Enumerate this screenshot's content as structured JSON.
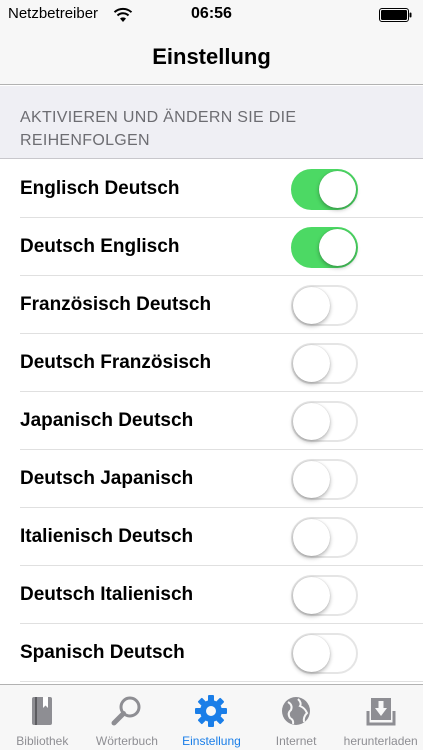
{
  "status_bar": {
    "carrier": "Netzbetreiber",
    "time": "06:56"
  },
  "nav": {
    "title": "Einstellung"
  },
  "section_header": "AKTIVIEREN UND ÄNDERN SIE DIE REIHENFOLGEN",
  "rows": [
    {
      "label": "Englisch Deutsch",
      "on": true
    },
    {
      "label": "Deutsch Englisch",
      "on": true
    },
    {
      "label": "Französisch Deutsch",
      "on": false
    },
    {
      "label": "Deutsch Französisch",
      "on": false
    },
    {
      "label": "Japanisch Deutsch",
      "on": false
    },
    {
      "label": "Deutsch Japanisch",
      "on": false
    },
    {
      "label": "Italienisch Deutsch",
      "on": false
    },
    {
      "label": "Deutsch Italienisch",
      "on": false
    },
    {
      "label": "Spanisch Deutsch",
      "on": false
    }
  ],
  "tabs": [
    {
      "label": "Bibliothek",
      "icon": "book-icon",
      "active": false
    },
    {
      "label": "Wörterbuch",
      "icon": "magnifier-icon",
      "active": false
    },
    {
      "label": "Einstellung",
      "icon": "gear-icon",
      "active": true
    },
    {
      "label": "Internet",
      "icon": "globe-icon",
      "active": false
    },
    {
      "label": "herunterladen",
      "icon": "download-icon",
      "active": false
    }
  ],
  "colors": {
    "toggle_on": "#4cd964",
    "tab_active": "#1a7ee8",
    "tab_inactive": "#8e8e93",
    "header_bg": "#efeff4"
  }
}
